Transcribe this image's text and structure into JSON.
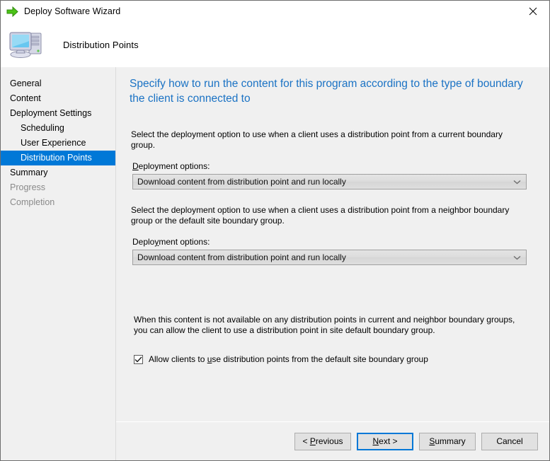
{
  "window": {
    "title": "Deploy Software Wizard",
    "title_icon": "green-arrow-icon",
    "close_label": "×"
  },
  "header": {
    "title": "Distribution Points",
    "icon": "computer-icon"
  },
  "sidebar": {
    "items": [
      {
        "label": "General",
        "level": 0,
        "state": "normal"
      },
      {
        "label": "Content",
        "level": 0,
        "state": "normal"
      },
      {
        "label": "Deployment Settings",
        "level": 0,
        "state": "normal"
      },
      {
        "label": "Scheduling",
        "level": 1,
        "state": "normal"
      },
      {
        "label": "User Experience",
        "level": 1,
        "state": "normal"
      },
      {
        "label": "Distribution Points",
        "level": 1,
        "state": "selected"
      },
      {
        "label": "Summary",
        "level": 0,
        "state": "normal"
      },
      {
        "label": "Progress",
        "level": 0,
        "state": "disabled"
      },
      {
        "label": "Completion",
        "level": 0,
        "state": "disabled"
      }
    ],
    "selected_color": "#0078d7"
  },
  "content": {
    "heading": "Specify how to run the content for this program according to the type of boundary the client is connected to",
    "heading_color": "#1a72c4",
    "intro_current": "Select the deployment option to use when a client uses a distribution point from a current boundary group.",
    "intro_neighbor": "Select the deployment option to use when a client uses a distribution point from a neighbor boundary group or the default site boundary group.",
    "label_deployment_options_1": "Deployment options:",
    "label_deployment_options_1_accel": "D",
    "label_deployment_options_2": "Deployment options:",
    "label_deployment_options_2_accel": "y",
    "combo_current_value": "Download content from distribution point and run locally",
    "combo_neighbor_value": "Download content from distribution point and run locally",
    "combo_arrow_icon": "chevron-down-icon",
    "note": "When this content is not available on any distribution points in current and neighbor boundary groups, you can allow the client to use a distribution point in site default boundary group.",
    "checkbox_label": "Allow clients to use distribution points from the default site boundary group",
    "checkbox_accel": "u",
    "checkbox_checked": true
  },
  "footer": {
    "buttons": [
      {
        "label": "< Previous",
        "accel": "P",
        "default": false
      },
      {
        "label": "Next >",
        "accel": "N",
        "default": true
      },
      {
        "label": "Summary",
        "accel": "S",
        "default": false
      },
      {
        "label": "Cancel",
        "accel": "",
        "default": false
      }
    ]
  }
}
